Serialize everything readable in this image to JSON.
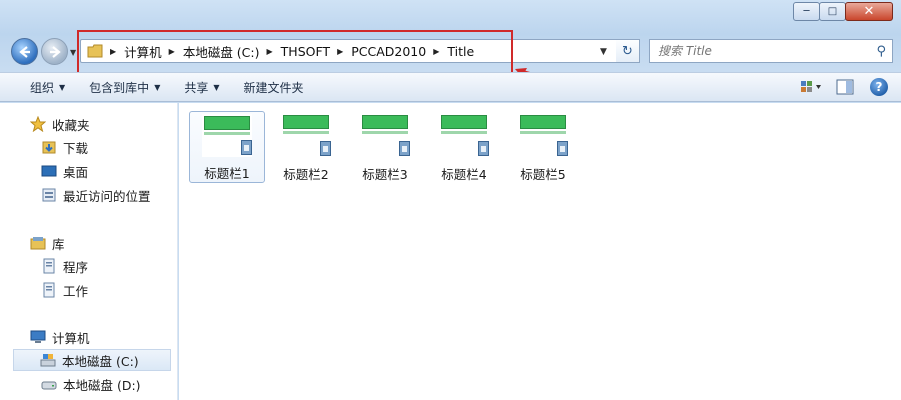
{
  "window": {
    "minimize_icon": "minimize-icon",
    "maximize_icon": "maximize-icon",
    "close_icon": "close-icon"
  },
  "address_bar": {
    "crumbs": [
      "计算机",
      "本地磁盘 (C:)",
      "THSOFT",
      "PCCAD2010",
      "Title"
    ]
  },
  "search": {
    "placeholder": "搜索 Title"
  },
  "toolbar": {
    "organize": "组织",
    "include_in_library": "包含到库中",
    "share": "共享",
    "new_folder": "新建文件夹"
  },
  "nav_pane": {
    "favorites": "收藏夹",
    "downloads": "下载",
    "desktop": "桌面",
    "recent": "最近访问的位置",
    "libraries": "库",
    "programs": "程序",
    "work": "工作",
    "computer": "计算机",
    "drive_c": "本地磁盘 (C:)",
    "drive_d": "本地磁盘 (D:)"
  },
  "files": [
    {
      "name": "标题栏1"
    },
    {
      "name": "标题栏2"
    },
    {
      "name": "标题栏3"
    },
    {
      "name": "标题栏4"
    },
    {
      "name": "标题栏5"
    }
  ],
  "colors": {
    "annotation": "#d02a2a",
    "accent": "#2f6fbe"
  }
}
